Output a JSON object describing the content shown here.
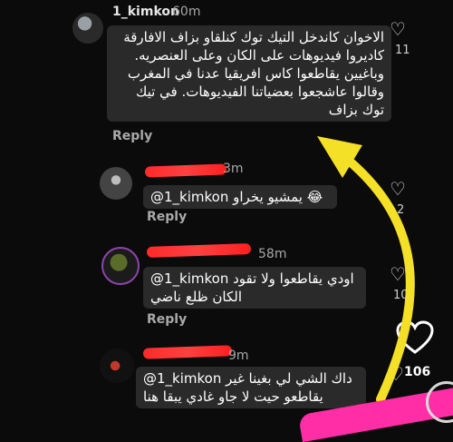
{
  "main_comment": {
    "username": "1_kimkon",
    "time": "60m",
    "lines": [
      "الاخوان كاندخل التيك توك كنلقاو بزاف الافارقة",
      "كاديروا فيديوهات على الكان وعلى العنصريه.",
      "وباغيين يقاطعوا كاس افريقيا عدنا في المغرب",
      "وقالوا عاشجعوا بعضياتنا الفيديوهات. في تيك",
      "توك بزاف"
    ],
    "reply_label": "Reply",
    "like_count": "11"
  },
  "replies": [
    {
      "time": "3m",
      "text": "@1_kimkon يمشيو يخراو 😂",
      "reply_label": "Reply",
      "like_count": "2"
    },
    {
      "username_fragment": "..._..._.....",
      "time": "58m",
      "text_lines": [
        "@1_kimkon اودي يقاطعوا ولا تقود",
        "الكان ظلع ناضي"
      ],
      "reply_label": "Reply",
      "like_count": "10"
    },
    {
      "time": "9m",
      "text_lines": [
        "@1_kimkon داك الشي لي بغينا غير",
        "يقاطعو حيت لا جاو غادي يبقا هنا"
      ],
      "like_count": ""
    }
  ],
  "side": {
    "big_like_count": "106"
  },
  "colors": {
    "background": "#0b0b0b",
    "bubble": "#2a2a2a",
    "redaction": "#ff2a2a",
    "annotation_arrow": "#f4e026"
  }
}
